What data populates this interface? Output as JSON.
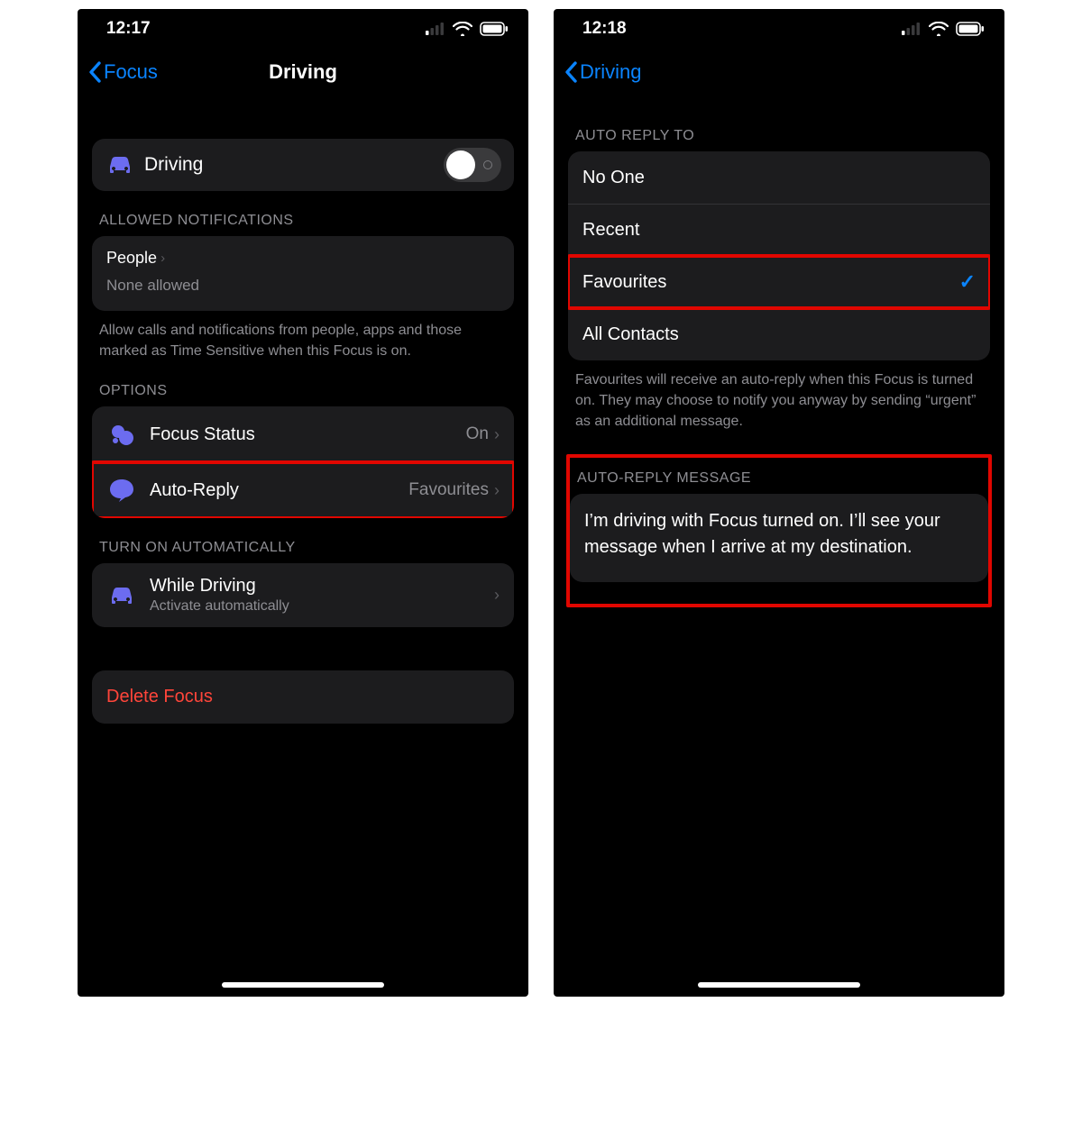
{
  "left": {
    "status": {
      "time": "12:17"
    },
    "nav": {
      "back_label": "Focus",
      "title": "Driving"
    },
    "toggle": {
      "label": "Driving"
    },
    "allowed": {
      "header": "ALLOWED NOTIFICATIONS",
      "people_label": "People",
      "people_sub": "None allowed",
      "footer": "Allow calls and notifications from people, apps and those marked as Time Sensitive when this Focus is on."
    },
    "options": {
      "header": "OPTIONS",
      "focus_status_label": "Focus Status",
      "focus_status_value": "On",
      "auto_reply_label": "Auto-Reply",
      "auto_reply_value": "Favourites"
    },
    "auto_on": {
      "header": "TURN ON AUTOMATICALLY",
      "label": "While Driving",
      "sub": "Activate automatically"
    },
    "delete_label": "Delete Focus"
  },
  "right": {
    "status": {
      "time": "12:18"
    },
    "nav": {
      "back_label": "Driving"
    },
    "auto_reply_to": {
      "header": "AUTO REPLY TO",
      "items": [
        "No One",
        "Recent",
        "Favourites",
        "All Contacts"
      ],
      "selected_index": 2,
      "footer": "Favourites will receive an auto-reply when this Focus is turned on. They may choose to notify you anyway by sending “urgent” as an additional message."
    },
    "auto_reply_message": {
      "header": "AUTO-REPLY MESSAGE",
      "body": "I’m driving with Focus turned on. I’ll see your message when I arrive at my destination."
    }
  },
  "colors": {
    "accent": "#0a84ff",
    "danger": "#ff453a",
    "icon_purple": "#6c6cf0",
    "highlight": "#e10600"
  }
}
